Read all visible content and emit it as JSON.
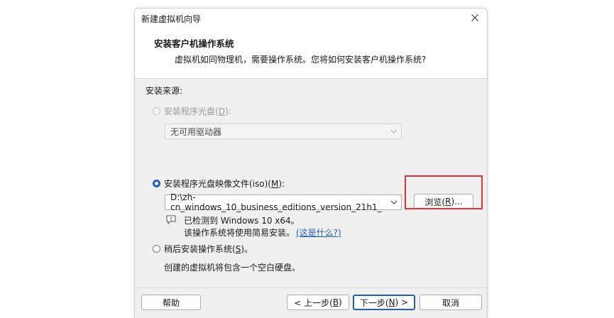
{
  "window": {
    "title": "新建虚拟机向导"
  },
  "header": {
    "title": "安装客户机操作系统",
    "subtitle": "虚拟机如同物理机，需要操作系统。您将如何安装客户机操作系统?"
  },
  "install_source": {
    "label": "安装来源:",
    "disc_option": {
      "label_prefix": "安装程序光盘(",
      "mnemonic": "D",
      "label_suffix": "):",
      "dropdown_value": "无可用驱动器"
    },
    "iso_option": {
      "label_prefix": "安装程序光盘映像文件(iso)(",
      "mnemonic": "M",
      "label_suffix": "):",
      "path_value": "D:\\zh-cn_windows_10_business_editions_version_21h1_",
      "browse_prefix": "浏览(",
      "browse_mnemonic": "R",
      "browse_suffix": ")..."
    },
    "detection": {
      "line1": "已检测到 Windows 10 x64。",
      "line2": "该操作系统将使用简易安装。",
      "link": "(这是什么?)"
    },
    "later_option": {
      "label_prefix": "稍后安装操作系统(",
      "mnemonic": "S",
      "label_suffix": ")。",
      "description": "创建的虚拟机将包含一个空白硬盘。"
    }
  },
  "footer": {
    "help": "帮助",
    "back_prefix": "< 上一步(",
    "back_mnemonic": "B",
    "back_suffix": ")",
    "next_prefix": "下一步(",
    "next_mnemonic": "N",
    "next_suffix": ") >",
    "cancel": "取消"
  },
  "colors": {
    "accent": "#1f5fbf",
    "highlight": "#e03333"
  }
}
